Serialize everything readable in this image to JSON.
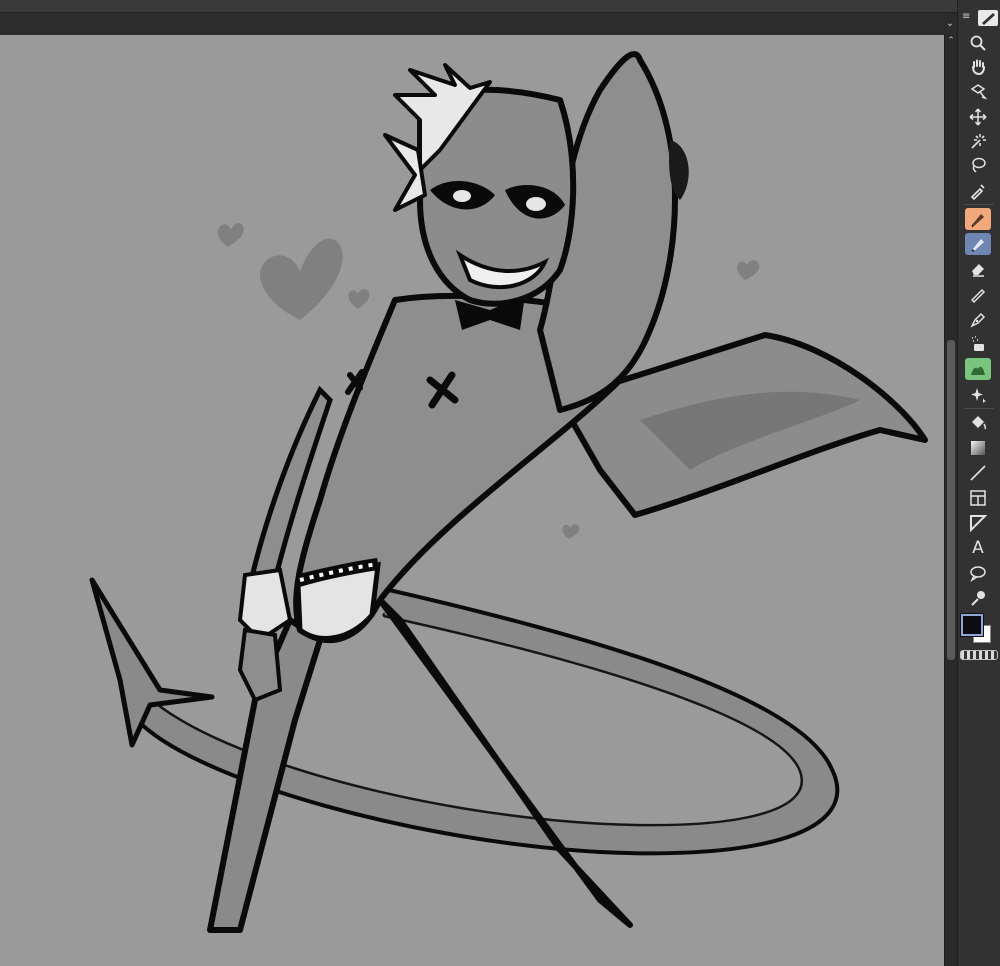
{
  "app": {
    "accent_colors": {
      "canvas_background": "#9a9a9a",
      "pen_tool_highlight": "#f1a97c",
      "pencil_tool_highlight": "#6f86b3",
      "blend_tool_highlight": "#7bc47f",
      "foreground_color": "#0c0c12",
      "background_color": "#ffffff"
    }
  },
  "toolbox": {
    "tools": [
      {
        "icon": "zoom-icon",
        "selected": false
      },
      {
        "icon": "hand-icon",
        "selected": false
      },
      {
        "icon": "rotate-icon",
        "selected": false
      },
      {
        "icon": "move-icon",
        "selected": false
      },
      {
        "icon": "magic-wand-icon",
        "selected": false
      },
      {
        "icon": "lasso-icon",
        "selected": false
      },
      {
        "icon": "eyedropper-icon",
        "selected": false
      },
      {
        "icon": "pen-icon",
        "selected": true
      },
      {
        "icon": "pencil-icon",
        "selected": true
      },
      {
        "icon": "eraser-icon",
        "selected": false
      },
      {
        "icon": "ruler-icon",
        "selected": false
      },
      {
        "icon": "vector-pen-icon",
        "selected": false
      },
      {
        "icon": "airbrush-icon",
        "selected": false
      },
      {
        "icon": "blend-icon",
        "selected": true
      },
      {
        "icon": "sparkle-icon",
        "selected": false
      },
      {
        "icon": "fill-icon",
        "selected": false
      },
      {
        "icon": "gradient-icon",
        "selected": false
      },
      {
        "icon": "line-icon",
        "selected": false
      },
      {
        "icon": "frame-icon",
        "selected": false
      },
      {
        "icon": "ruler-triangle-icon",
        "selected": false
      },
      {
        "icon": "text-icon",
        "selected": false
      },
      {
        "icon": "balloon-icon",
        "selected": false
      },
      {
        "icon": "correct-line-icon",
        "selected": false
      }
    ],
    "text_tool_label": "A"
  }
}
